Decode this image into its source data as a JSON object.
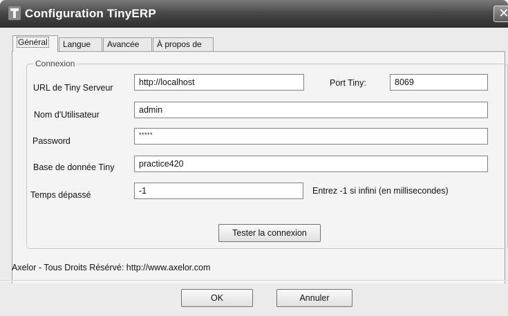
{
  "window": {
    "title": "Configuration TinyERP",
    "close_glyph": "✕",
    "icon": "tinyerp-app-icon"
  },
  "tabs": [
    {
      "label": "Général",
      "active": true
    },
    {
      "label": "Langue",
      "active": false
    },
    {
      "label": "Avancée",
      "active": false
    },
    {
      "label": "À propos de",
      "active": false
    }
  ],
  "connexion": {
    "legend": "Connexion",
    "url_label": "URL de Tiny Serveur",
    "url_value": "http://localhost",
    "port_label": "Port Tiny:",
    "port_value": "8069",
    "user_label": "Nom d'Utilisateur",
    "user_value": "admin",
    "password_label": "Password",
    "password_value": "*****",
    "db_label": "Base de donnée Tiny",
    "db_value": "practice420",
    "timeout_label": "Temps dépassé",
    "timeout_value": "-1",
    "timeout_hint": "Entrez -1 si infini (en millisecondes)",
    "test_button": "Tester la connexion"
  },
  "footer_note": "Axelor - Tous Droits Résérvé: http://www.axelor.com",
  "buttons": {
    "ok": "OK",
    "cancel": "Annuler"
  }
}
